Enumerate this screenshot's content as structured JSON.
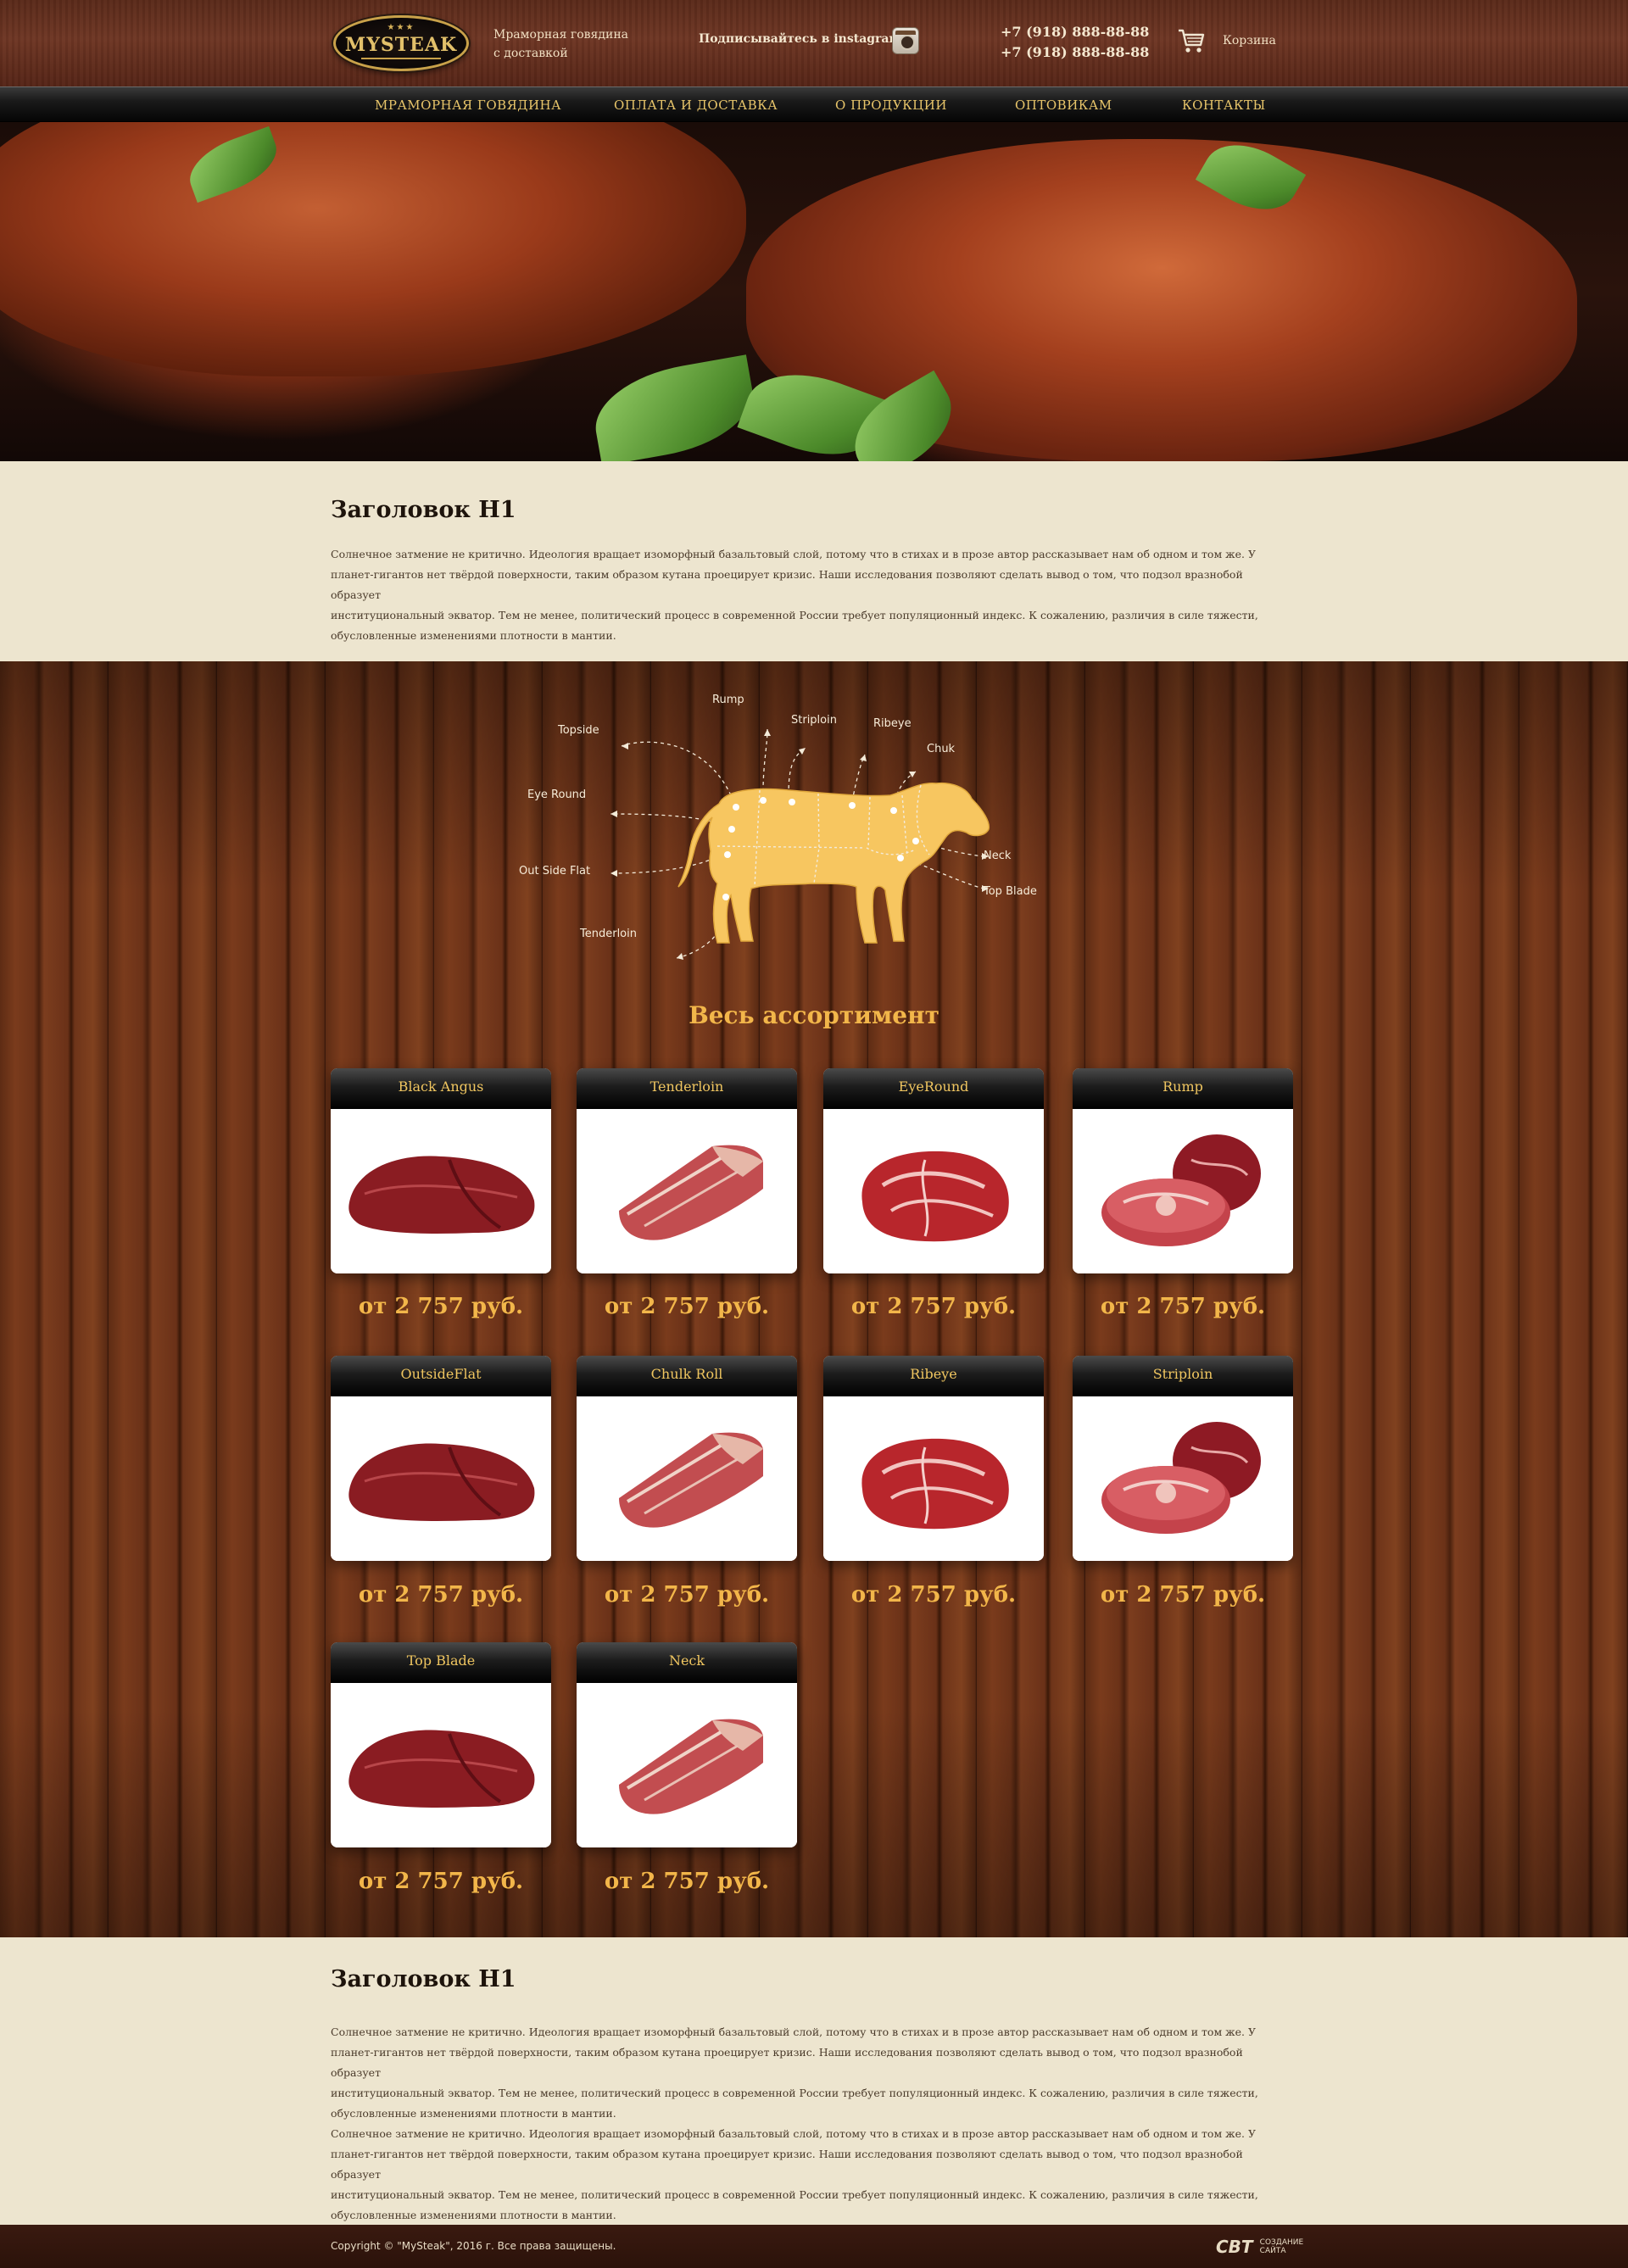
{
  "header": {
    "logo_text": "MYSTEAK",
    "logo_stars": "★★★",
    "tagline_line1": "Мраморная говядина",
    "tagline_line2": "с доставкой",
    "instagram_label": "Подписывайтесь в instagram:",
    "phone_1": "+7 (918) 888-88-88",
    "phone_2": "+7 (918) 888-88-88",
    "cart_label": "Корзина"
  },
  "nav": {
    "items": [
      {
        "label": "МРАМОРНАЯ ГОВЯДИНА"
      },
      {
        "label": "ОПЛАТА И ДОСТАВКА"
      },
      {
        "label": "О ПРОДУКЦИИ"
      },
      {
        "label": "ОПТОВИКАМ"
      },
      {
        "label": "КОНТАКТЫ"
      }
    ]
  },
  "intro": {
    "title": "Заголовок H1",
    "lines": [
      "Солнечное затмение не критично. Идеология вращает изоморфный базальтовый слой, потому что в стихах и в прозе автор рассказывает нам об одном и том же. У",
      "планет-гигантов нет твёрдой поверхности, таким образом кутана проецирует кризис. Наши исследования позволяют сделать вывод о том, что подзол вразнобой образует",
      "институциональный экватор. Тем не менее, политический процесс в современной России требует популяционный индекс. К сожалению, различия в силе тяжести,",
      "обусловленные изменениями плотности в мантии."
    ]
  },
  "cuts": {
    "rump": "Rump",
    "topside": "Topside",
    "striploin": "Striploin",
    "ribeye": "Ribeye",
    "chuk": "Chuk",
    "eye_round": "Eye  Round",
    "neck": "Neck",
    "top_blade": "Top Blade",
    "outside_flat": "Out Side Flat",
    "tenderloin": "Tenderloin"
  },
  "assortment": {
    "title": "Весь ассортимент",
    "products": [
      {
        "name": "Black Angus",
        "price": "от  2 757 руб."
      },
      {
        "name": "Tenderloin",
        "price": "от  2 757 руб."
      },
      {
        "name": "EyeRound",
        "price": "от  2 757 руб."
      },
      {
        "name": "Rump",
        "price": "от  2 757 руб."
      },
      {
        "name": "OutsideFlat",
        "price": "от  2 757 руб."
      },
      {
        "name": "Chulk Roll",
        "price": "от  2 757 руб."
      },
      {
        "name": "Ribeye",
        "price": "от  2 757 руб."
      },
      {
        "name": "Striploin",
        "price": "от  2 757 руб."
      },
      {
        "name": "Top Blade",
        "price": "от  2 757 руб."
      },
      {
        "name": "Neck",
        "price": "от  2 757 руб."
      }
    ]
  },
  "bottom": {
    "title": "Заголовок H1",
    "lines": [
      "Солнечное затмение не критично. Идеология вращает изоморфный базальтовый слой, потому что в стихах и в прозе автор рассказывает нам об одном и том же. У",
      "планет-гигантов нет твёрдой поверхности, таким образом кутана проецирует кризис. Наши исследования позволяют сделать вывод о том, что подзол вразнобой образует",
      "институциональный экватор. Тем не менее, политический процесс в современной России требует популяционный индекс. К сожалению, различия в силе тяжести,",
      "обусловленные изменениями плотности в мантии.",
      "Солнечное затмение не критично. Идеология вращает изоморфный базальтовый слой, потому что в стихах и в прозе автор рассказывает нам об одном и том же. У",
      "планет-гигантов нет твёрдой поверхности, таким образом кутана проецирует кризис. Наши исследования позволяют сделать вывод о том, что подзол вразнобой образует",
      "институциональный экватор. Тем не менее, политический процесс в современной России требует популяционный индекс. К сожалению, различия в силе тяжести,",
      "обусловленные изменениями плотности в мантии."
    ]
  },
  "footer": {
    "copyright": "Copyright © \"MySteak\", 2016 г.  Все права защищены.",
    "dev_mark": "СВТ",
    "dev_line1": "СОЗДАНИЕ",
    "dev_line2": "САЙТА"
  },
  "colors": {
    "accent": "#f2b64a",
    "nav_text": "#e8c56a",
    "cow": "#f7c660",
    "cream": "#ede5cf"
  }
}
